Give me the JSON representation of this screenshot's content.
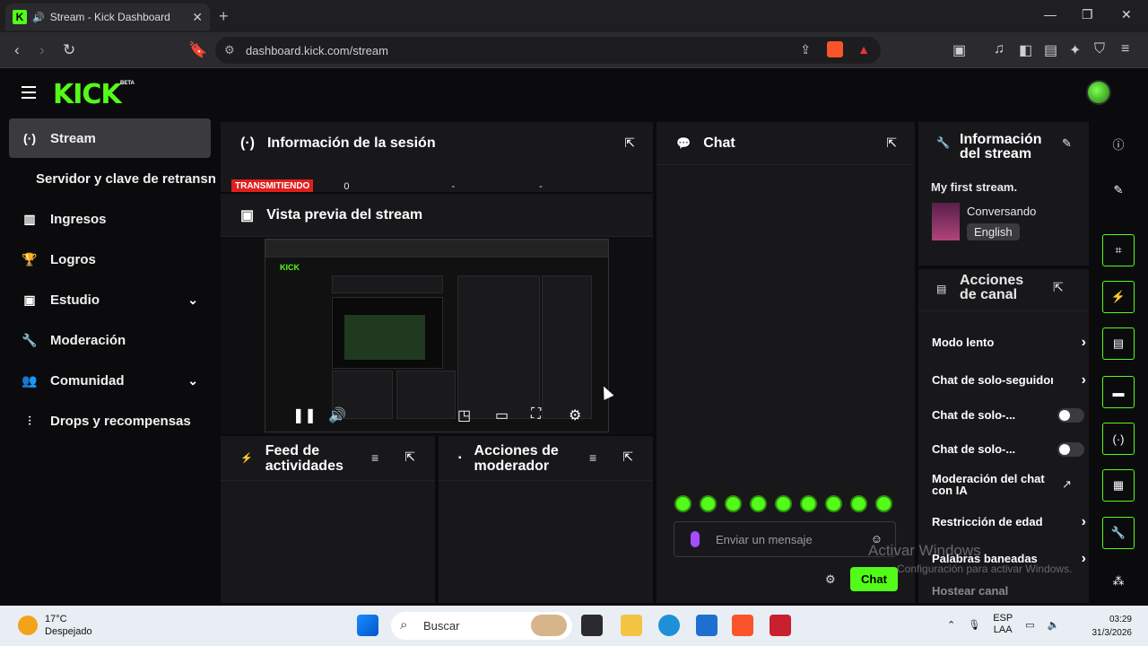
{
  "browser": {
    "tab_title": "Stream - Kick Dashboard",
    "url": "dashboard.kick.com/stream"
  },
  "header": {
    "logo": "KICK",
    "beta": "BETA"
  },
  "sidebar": {
    "items": [
      {
        "label": "Stream",
        "icon": "broadcast-icon"
      },
      {
        "label": "Servidor y clave de retransn"
      },
      {
        "label": "Ingresos",
        "icon": "chart-icon"
      },
      {
        "label": "Logros",
        "icon": "trophy-icon"
      },
      {
        "label": "Estudio",
        "icon": "studio-icon"
      },
      {
        "label": "Moderación",
        "icon": "wrench-icon"
      },
      {
        "label": "Comunidad",
        "icon": "community-icon"
      },
      {
        "label": "Drops y recompensas",
        "icon": "drops-icon"
      }
    ]
  },
  "session": {
    "title": "Información de la sesión",
    "status": "TRANSMITIENDO",
    "viewers": "0",
    "dash1": "-",
    "dash2": "-"
  },
  "preview": {
    "title": "Vista previa del stream"
  },
  "feed": {
    "title_l1": "Feed de",
    "title_l2": "actividades"
  },
  "modactions": {
    "title_l1": "Acciones de",
    "title_l2": "moderador"
  },
  "chat": {
    "title": "Chat",
    "placeholder": "Enviar un mensaje",
    "send_label": "Chat"
  },
  "stream_info": {
    "title_l1": "Información",
    "title_l2": "del stream",
    "stream_title": "My first stream.",
    "category": "Conversando",
    "language": "English"
  },
  "channel_actions": {
    "title_l1": "Acciones",
    "title_l2": "de canal",
    "items": [
      {
        "label": "Modo lento"
      },
      {
        "label": "Chat de solo-seguidoı"
      },
      {
        "label": "Chat de solo-..."
      },
      {
        "label": "Chat de solo-..."
      },
      {
        "label": "Moderación del chat con IA"
      },
      {
        "label": "Restricción de edad"
      },
      {
        "label": "Palabras baneadas"
      },
      {
        "label": "Hostear canal"
      }
    ]
  },
  "watermark": {
    "line1": "Activar Windows",
    "line2": "Configuración para activar Windows."
  },
  "taskbar": {
    "temp": "17°C",
    "weather": "Despejado",
    "search": "Buscar",
    "lang1": "ESP",
    "lang2": "LAA",
    "time": "03:29",
    "date": "31/3/2026"
  }
}
